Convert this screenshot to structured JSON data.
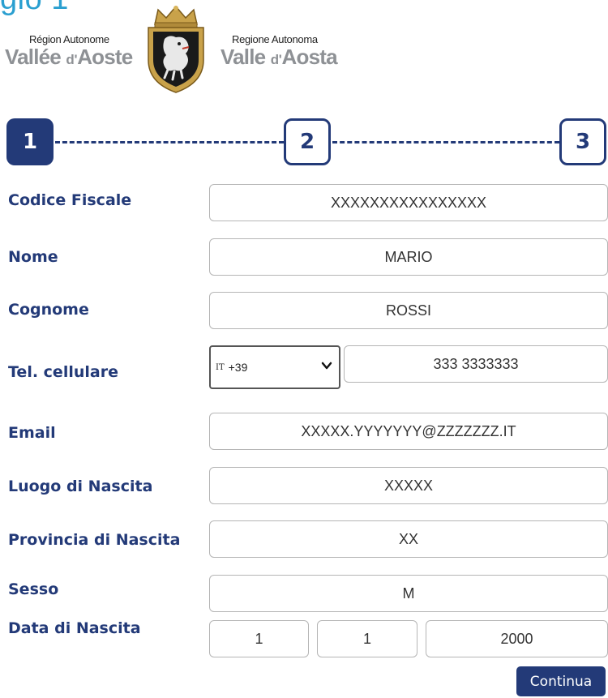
{
  "page": {
    "title_fragment": "gio 1"
  },
  "logos": {
    "left": {
      "line1": "Région Autonome",
      "big_pre": "Vallée ",
      "big_small": "d'",
      "big_post": "Aoste"
    },
    "right": {
      "line1": "Regione Autonoma",
      "big_pre": "Valle ",
      "big_small": "d'",
      "big_post": "Aosta"
    }
  },
  "stepper": {
    "steps": [
      "1",
      "2",
      "3"
    ],
    "active_step": 1
  },
  "form": {
    "codice_fiscale": {
      "label": "Codice Fiscale",
      "value": "XXXXXXXXXXXXXXXX"
    },
    "nome": {
      "label": "Nome",
      "value": "MARIO"
    },
    "cognome": {
      "label": "Cognome",
      "value": "ROSSI"
    },
    "tel": {
      "label": "Tel. cellulare",
      "country_code": "IT",
      "prefix": "+39",
      "number": "333 3333333"
    },
    "email": {
      "label": "Email",
      "value": "XXXXX.YYYYYYY@ZZZZZZZ.IT"
    },
    "luogo": {
      "label": "Luogo di Nascita",
      "value": "XXXXX"
    },
    "provincia": {
      "label": "Provincia di Nascita",
      "value": "XX"
    },
    "sesso": {
      "label": "Sesso",
      "value": "M"
    },
    "data": {
      "label": "Data di Nascita",
      "day": "1",
      "month": "1",
      "year": "2000"
    }
  },
  "actions": {
    "continue_label": "Continua"
  },
  "colors": {
    "primary": "#233a78",
    "title": "#2a9fd0",
    "logo_gray": "#8e9195",
    "border": "#b5b5b5"
  },
  "icons": {
    "select_chevron": "chevron-down-icon",
    "emblem": "coat-of-arms-icon"
  }
}
